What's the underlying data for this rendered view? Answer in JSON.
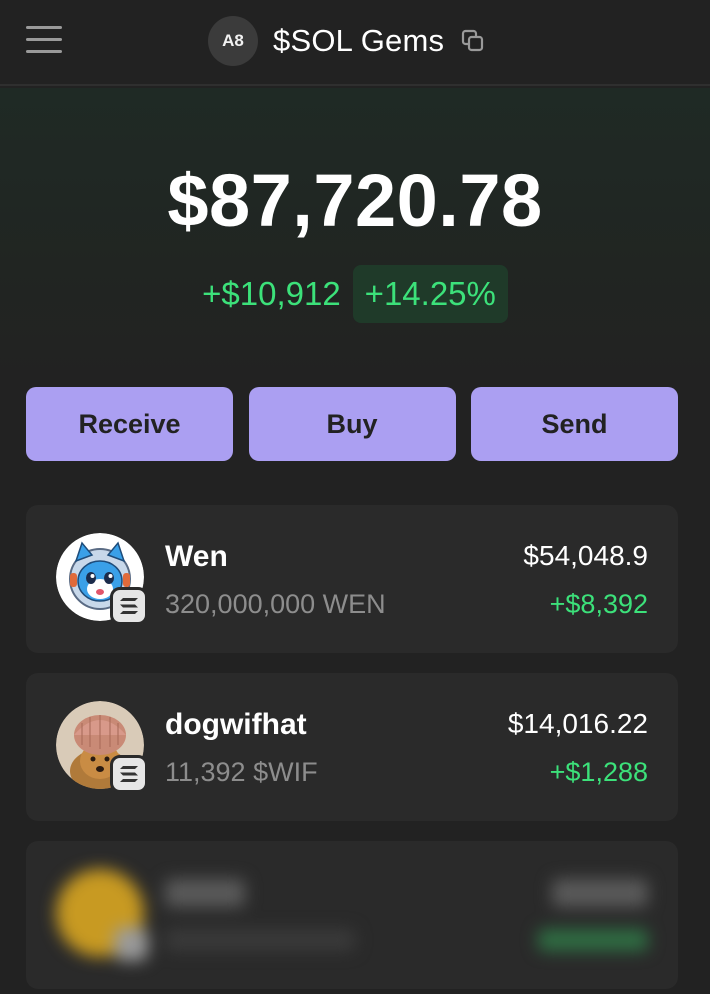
{
  "header": {
    "avatar_initials": "A8",
    "wallet_name": "$SOL Gems",
    "menu_icon": "hamburger-menu-icon",
    "copy_icon": "copy-icon"
  },
  "balance": {
    "total": "$87,720.78",
    "change_abs": "+$10,912",
    "change_pct": "+14.25%"
  },
  "actions": {
    "receive": "Receive",
    "buy": "Buy",
    "send": "Send"
  },
  "tokens": [
    {
      "name": "Wen",
      "amount": "320,000,000 WEN",
      "value": "$54,048.9",
      "change": "+$8,392",
      "chain_icon": "solana-icon"
    },
    {
      "name": "dogwifhat",
      "amount": "11,392 $WIF",
      "value": "$14,016.22",
      "change": "+$1,288",
      "chain_icon": "solana-icon"
    }
  ],
  "colors": {
    "background": "#222222",
    "accent": "#ab9ff2",
    "positive": "#3ce17a",
    "card": "#2a2a2a"
  }
}
